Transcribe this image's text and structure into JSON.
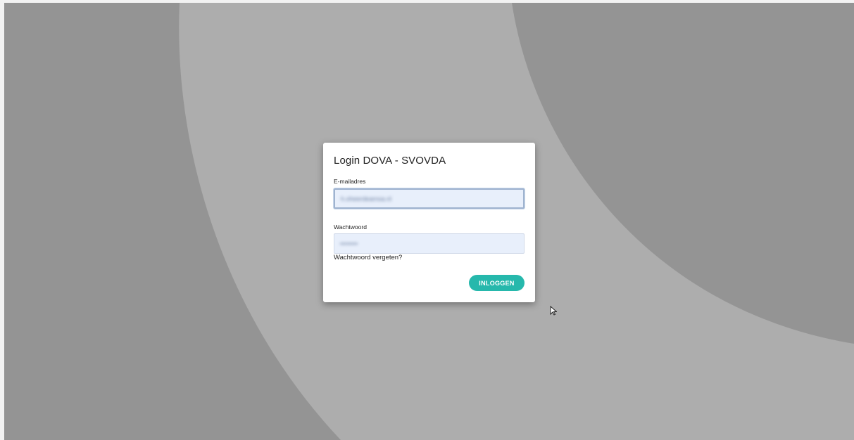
{
  "login": {
    "title": "Login DOVA - SVOVDA",
    "email_label": "E-mailadres",
    "email_value": "h.oheerdeamsa.nl",
    "password_label": "Wachtwoord",
    "password_value": "••••••••",
    "forgot_password": "Wachtwoord vergeten?",
    "submit_label": "INLOGGEN"
  },
  "colors": {
    "backdrop_dark": "#949494",
    "backdrop_light": "#adadad",
    "card": "#ffffff",
    "input_fill": "#e8effb",
    "accent": "#26b8ac"
  },
  "icons": {
    "cursor": "mouse-pointer-icon"
  }
}
